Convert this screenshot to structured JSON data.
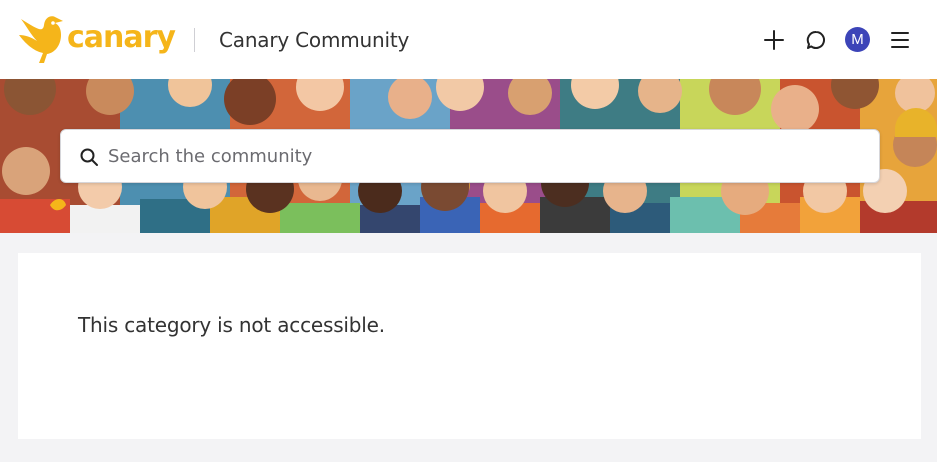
{
  "header": {
    "logo_text": "canary",
    "site_title": "Canary Community",
    "avatar_initial": "M",
    "icons": {
      "new": "plus-icon",
      "chat": "chat-bubble-icon",
      "menu": "hamburger-menu-icon",
      "logo": "canary-bird-logo"
    }
  },
  "search": {
    "placeholder": "Search the community",
    "value": ""
  },
  "main": {
    "message": "This category is not accessible."
  },
  "colors": {
    "brand_yellow": "#f5b51a",
    "avatar_bg": "#3c44b8",
    "page_bg": "#f3f3f5"
  }
}
